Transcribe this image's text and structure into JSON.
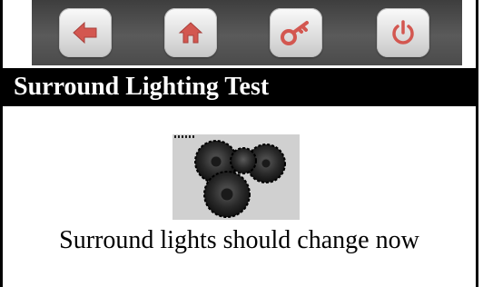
{
  "toolbar": {
    "buttons": [
      {
        "name": "back-button",
        "icon": "arrow-left-icon"
      },
      {
        "name": "home-button",
        "icon": "home-icon"
      },
      {
        "name": "key-button",
        "icon": "key-icon"
      },
      {
        "name": "power-button",
        "icon": "power-icon"
      }
    ],
    "icon_color": "#d9534f"
  },
  "page": {
    "title": "Surround Lighting Test"
  },
  "content": {
    "image": "fans-image",
    "message": "Surround lights should change now"
  }
}
